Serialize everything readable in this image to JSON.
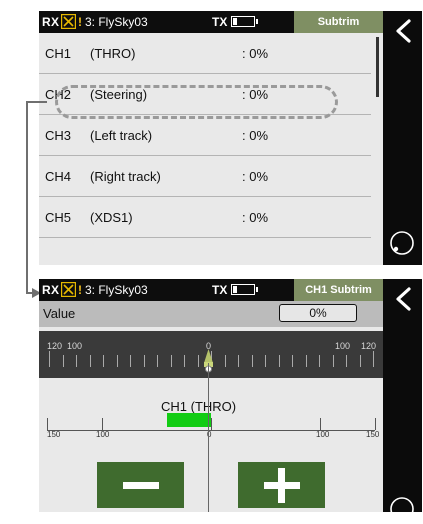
{
  "status_bar": {
    "rx_label": "RX",
    "warning_mark": "!",
    "model_name": "3: FlySky03",
    "tx_label": "TX",
    "tx_battery_level": 0.2
  },
  "subtrim_list": {
    "title": "Subtrim",
    "rows": [
      {
        "channel": "CH1",
        "name": "(THRO)",
        "value": ": 0%"
      },
      {
        "channel": "CH2",
        "name": "(Steering)",
        "value": ": 0%"
      },
      {
        "channel": "CH3",
        "name": "(Left track)",
        "value": ": 0%"
      },
      {
        "channel": "CH4",
        "name": "(Right track)",
        "value": ": 0%"
      },
      {
        "channel": "CH5",
        "name": "(XDS1)",
        "value": ": 0%"
      }
    ]
  },
  "channel_detail": {
    "title": "CH1 Subtrim",
    "value_label": "Value",
    "value": "0%",
    "ruler_labels": {
      "left_outer": "120",
      "left_inner": "100",
      "center": "0",
      "right_inner": "100",
      "right_outer": "120"
    },
    "channel_label": "CH1  (THRO)",
    "axis_labels": {
      "left_outer": "150",
      "left_inner": "100",
      "center": "0",
      "right_inner": "100",
      "right_outer": "150"
    },
    "output_bar_range": [
      -40,
      0
    ]
  },
  "colors": {
    "header_tab": "#7f8f63",
    "button": "#3f6b2e",
    "output_bar": "#12cc14",
    "warning": "#f7c21d",
    "x_icon": "#e6b800"
  },
  "icons": {
    "back": "chevron-left-icon",
    "rotate": "rotate-icon",
    "decrease": "minus-icon",
    "increase": "plus-icon"
  }
}
